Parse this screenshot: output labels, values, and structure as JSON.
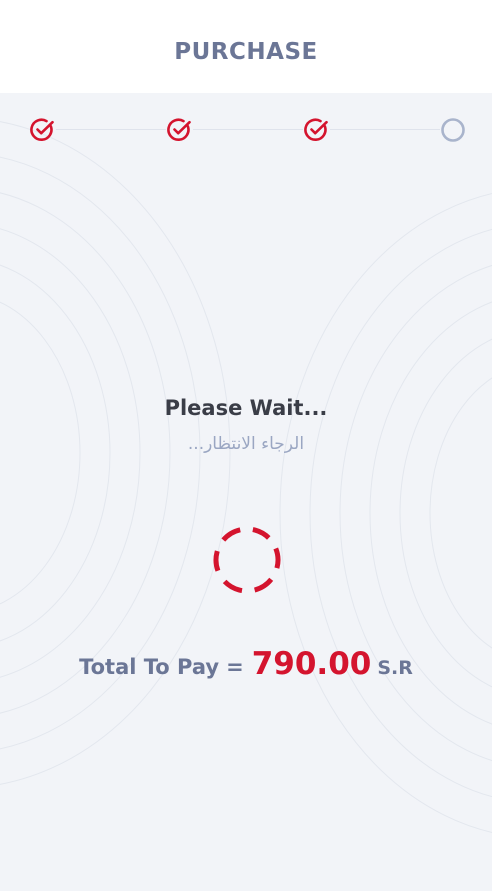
{
  "header": {
    "title": "PURCHASE"
  },
  "stepper": {
    "steps": [
      {
        "icon": "check-circle-icon",
        "state": "complete"
      },
      {
        "icon": "check-circle-icon",
        "state": "complete"
      },
      {
        "icon": "check-circle-icon",
        "state": "complete"
      },
      {
        "icon": "empty-circle-icon",
        "state": "pending"
      }
    ],
    "complete_color": "#d4142e",
    "pending_color": "#a9b4cc"
  },
  "status": {
    "title": "Please Wait...",
    "subtitle": "الرجاء الانتظار..."
  },
  "spinner": {
    "icon": "loading-spinner-icon",
    "color": "#d4142e"
  },
  "total": {
    "label": "Total To Pay",
    "equals": "=",
    "amount": "790.00",
    "currency": "S.R",
    "amount_color": "#d4142e"
  }
}
